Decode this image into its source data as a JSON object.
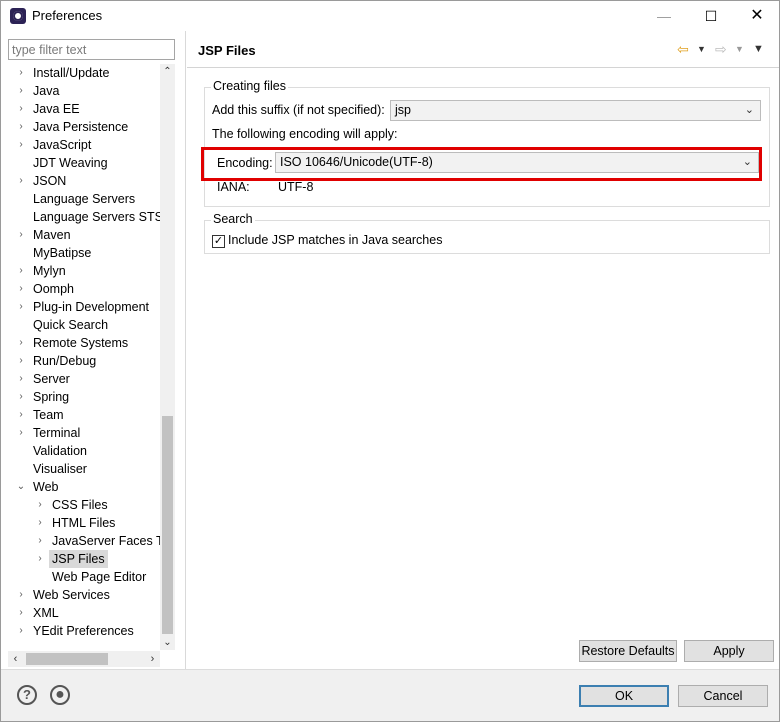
{
  "window": {
    "title": "Preferences"
  },
  "title_controls": {
    "minimize": "—",
    "maximize": "☐",
    "close": "✕"
  },
  "left": {
    "filter_placeholder": "type filter text",
    "tree": [
      {
        "label": "Install/Update",
        "level": 0,
        "twisty": "collapsed"
      },
      {
        "label": "Java",
        "level": 0,
        "twisty": "collapsed"
      },
      {
        "label": "Java EE",
        "level": 0,
        "twisty": "collapsed"
      },
      {
        "label": "Java Persistence",
        "level": 0,
        "twisty": "collapsed"
      },
      {
        "label": "JavaScript",
        "level": 0,
        "twisty": "collapsed"
      },
      {
        "label": "JDT Weaving",
        "level": 0,
        "twisty": "none"
      },
      {
        "label": "JSON",
        "level": 0,
        "twisty": "collapsed"
      },
      {
        "label": "Language Servers",
        "level": 0,
        "twisty": "none"
      },
      {
        "label": "Language Servers STS",
        "level": 0,
        "twisty": "none"
      },
      {
        "label": "Maven",
        "level": 0,
        "twisty": "collapsed"
      },
      {
        "label": "MyBatipse",
        "level": 0,
        "twisty": "none"
      },
      {
        "label": "Mylyn",
        "level": 0,
        "twisty": "collapsed"
      },
      {
        "label": "Oomph",
        "level": 0,
        "twisty": "collapsed"
      },
      {
        "label": "Plug-in Development",
        "level": 0,
        "twisty": "collapsed"
      },
      {
        "label": "Quick Search",
        "level": 0,
        "twisty": "none"
      },
      {
        "label": "Remote Systems",
        "level": 0,
        "twisty": "collapsed"
      },
      {
        "label": "Run/Debug",
        "level": 0,
        "twisty": "collapsed"
      },
      {
        "label": "Server",
        "level": 0,
        "twisty": "collapsed"
      },
      {
        "label": "Spring",
        "level": 0,
        "twisty": "collapsed"
      },
      {
        "label": "Team",
        "level": 0,
        "twisty": "collapsed"
      },
      {
        "label": "Terminal",
        "level": 0,
        "twisty": "collapsed"
      },
      {
        "label": "Validation",
        "level": 0,
        "twisty": "none"
      },
      {
        "label": "Visualiser",
        "level": 0,
        "twisty": "none"
      },
      {
        "label": "Web",
        "level": 0,
        "twisty": "expanded"
      },
      {
        "label": "CSS Files",
        "level": 1,
        "twisty": "collapsed"
      },
      {
        "label": "HTML Files",
        "level": 1,
        "twisty": "collapsed"
      },
      {
        "label": "JavaServer Faces Tools",
        "level": 1,
        "twisty": "collapsed"
      },
      {
        "label": "JSP Files",
        "level": 1,
        "twisty": "collapsed",
        "selected": true
      },
      {
        "label": "Web Page Editor",
        "level": 1,
        "twisty": "none"
      },
      {
        "label": "Web Services",
        "level": 0,
        "twisty": "collapsed"
      },
      {
        "label": "XML",
        "level": 0,
        "twisty": "collapsed"
      },
      {
        "label": "YEdit Preferences",
        "level": 0,
        "twisty": "collapsed"
      }
    ]
  },
  "page": {
    "title": "JSP Files",
    "creating_files": {
      "group_title": "Creating files",
      "suffix_label": "Add this suffix (if not specified):",
      "suffix_value": "jsp",
      "encoding_note": "The following encoding will apply:",
      "encoding_label": "Encoding:",
      "encoding_value": "ISO 10646/Unicode(UTF-8)",
      "iana_label": "IANA:",
      "iana_value": "UTF-8"
    },
    "search": {
      "group_title": "Search",
      "include_label": "Include JSP matches in Java searches",
      "include_checked": true
    },
    "restore_defaults": "Restore Defaults",
    "apply": "Apply"
  },
  "footer": {
    "ok": "OK",
    "cancel": "Cancel"
  },
  "colors": {
    "highlight": "#e00000",
    "default_button_border": "#3c7fb1",
    "back_arrow": "#e0a020"
  }
}
